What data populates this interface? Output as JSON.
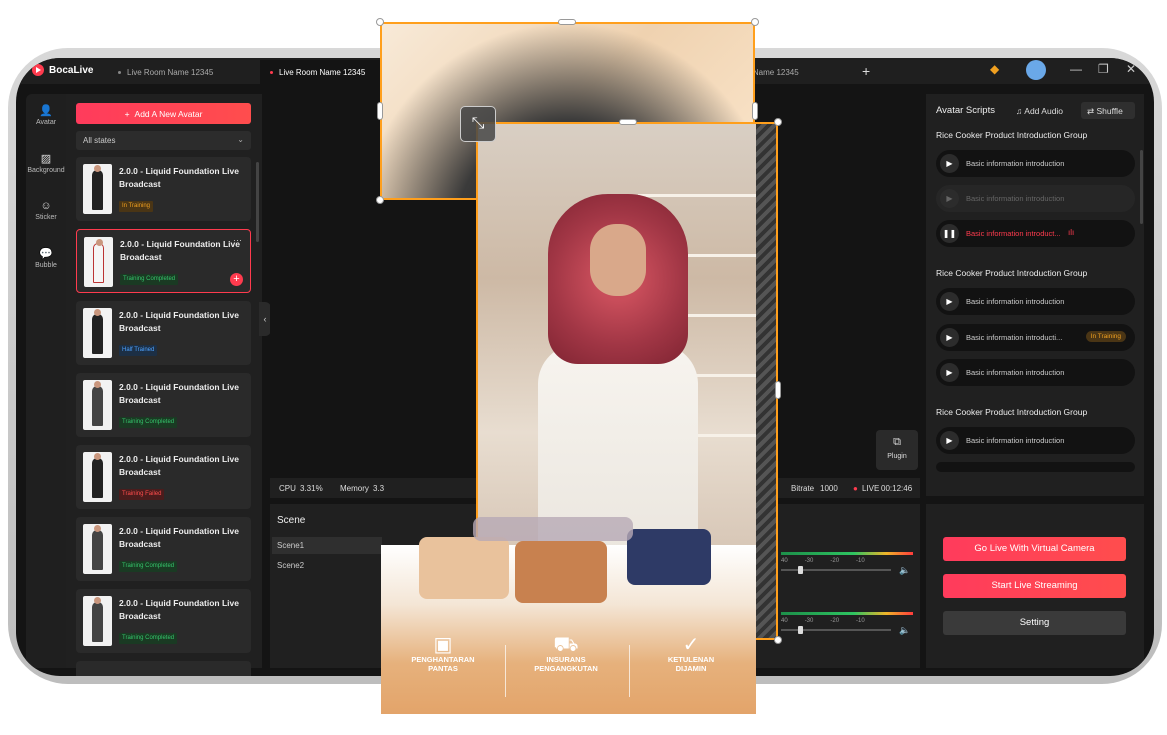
{
  "app": {
    "name": "BocaLive"
  },
  "tabs": [
    {
      "label": "Live Room Name 12345"
    },
    {
      "label": "Live Room Name 12345"
    },
    {
      "label": "m Name 12345"
    }
  ],
  "nav": [
    {
      "label": "Avatar",
      "icon": "person-icon"
    },
    {
      "label": "Background",
      "icon": "background-icon"
    },
    {
      "label": "Sticker",
      "icon": "sticker-icon"
    },
    {
      "label": "Bubble",
      "icon": "bubble-icon"
    }
  ],
  "avatar_panel": {
    "add_label": "Add A New Avatar",
    "filter_value": "All states",
    "items": [
      {
        "title": "2.0.0 - Liquid Foundation Live Broadcast",
        "status": "In Training"
      },
      {
        "title": "2.0.0 - Liquid Foundation Live Broadcast",
        "status": "Training Completed"
      },
      {
        "title": "2.0.0 - Liquid Foundation Live Broadcast",
        "status": "Half Trained"
      },
      {
        "title": "2.0.0 - Liquid Foundation Live Broadcast",
        "status": "Training Completed"
      },
      {
        "title": "2.0.0 - Liquid Foundation Live Broadcast",
        "status": "Training Failed"
      },
      {
        "title": "2.0.0 - Liquid Foundation Live Broadcast",
        "status": "Training Completed"
      },
      {
        "title": "2.0.0 - Liquid Foundation Live Broadcast",
        "status": "Training Completed"
      }
    ]
  },
  "status_bar": {
    "cpu_label": "CPU",
    "cpu_value": "3.31%",
    "memory_label": "Memory",
    "memory_value": "3.3",
    "bitrate_label": "Bitrate",
    "bitrate_value": "1000",
    "live_label": "LIVE",
    "live_time": "00:12:46"
  },
  "plugin": {
    "label": "Plugin"
  },
  "scene_panel": {
    "title": "Scene",
    "scenes": [
      "Scene1",
      "Scene2"
    ],
    "meter_ticks": [
      "40",
      "-30",
      "-20",
      "-10"
    ]
  },
  "scripts_panel": {
    "title": "Avatar Scripts",
    "add_audio": "Add Audio",
    "shuffle": "Shuffle",
    "groups": [
      {
        "name": "Rice Cooker Product Introduction Group",
        "items": [
          "Basic information introduction",
          "Basic information introduction",
          "Basic information introduct..."
        ]
      },
      {
        "name": "Rice Cooker Product Introduction Group",
        "items": [
          "Basic information introduction",
          "Basic information introducti...",
          "Basic information introduction"
        ]
      },
      {
        "name": "Rice Cooker Product Introduction Group",
        "items": [
          "Basic information introduction"
        ]
      }
    ],
    "in_training": "In Training"
  },
  "actions": {
    "virtual_camera": "Go Live With Virtual Camera",
    "start_streaming": "Start Live Streaming",
    "setting": "Setting"
  },
  "banner": {
    "features": [
      {
        "line1": "PENGHANTARAN",
        "line2": "PANTAS"
      },
      {
        "line1": "INSURANS",
        "line2": "PENGANGKUTAN"
      },
      {
        "line1": "KETULENAN",
        "line2": "DIJAMIN"
      }
    ]
  },
  "colors": {
    "accent": "#ff3b4e",
    "selection": "#ff9f1c"
  }
}
